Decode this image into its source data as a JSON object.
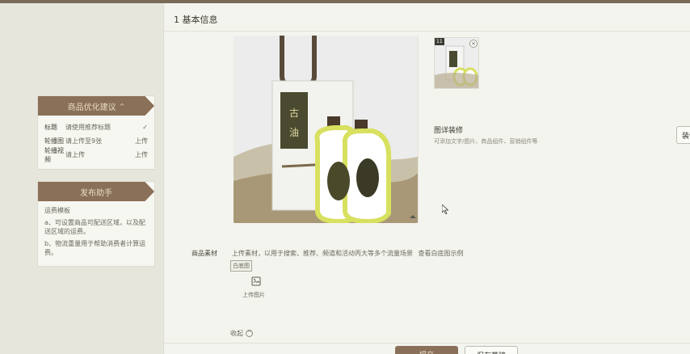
{
  "header": {
    "section_title": "1 基本信息"
  },
  "optimization_panel": {
    "title": "商品优化建议",
    "items": [
      {
        "key": "标题",
        "value": "请使用推荐标题",
        "status": "✓"
      },
      {
        "key": "轮播图",
        "value": "请上传至9张",
        "status": "上传"
      },
      {
        "key": "轮播视频",
        "value": "请上传",
        "status": "上传"
      }
    ]
  },
  "publish_panel": {
    "title": "发布助手",
    "heading": "运费模板",
    "lines": [
      "a、可设置商品可配送区域，以及配送区域的运费。",
      "b、物流重量用于帮助消费者计算运费。"
    ]
  },
  "thumbnail": {
    "badge": "11"
  },
  "detail": {
    "heading": "图详装修",
    "sub": "可添加文字/图片、商品组件、营销组件等",
    "edit_label": "装修"
  },
  "material": {
    "label": "商品素材",
    "desc": "上传素材，以用于搜索、推荐、频道和活动丙大等多个流量场景",
    "link": "查看白底图示例",
    "tag": "白底图",
    "upload_label": "上传图片"
  },
  "collapse": {
    "label": "收起"
  },
  "footer": {
    "submit_label": "提交",
    "save_label": "保存草稿"
  },
  "icons": {
    "check": "check-icon",
    "upload": "image-upload-icon",
    "cursor": "mouse-cursor-icon"
  },
  "colors": {
    "accent": "#8a7058",
    "background": "#ebebe3"
  }
}
